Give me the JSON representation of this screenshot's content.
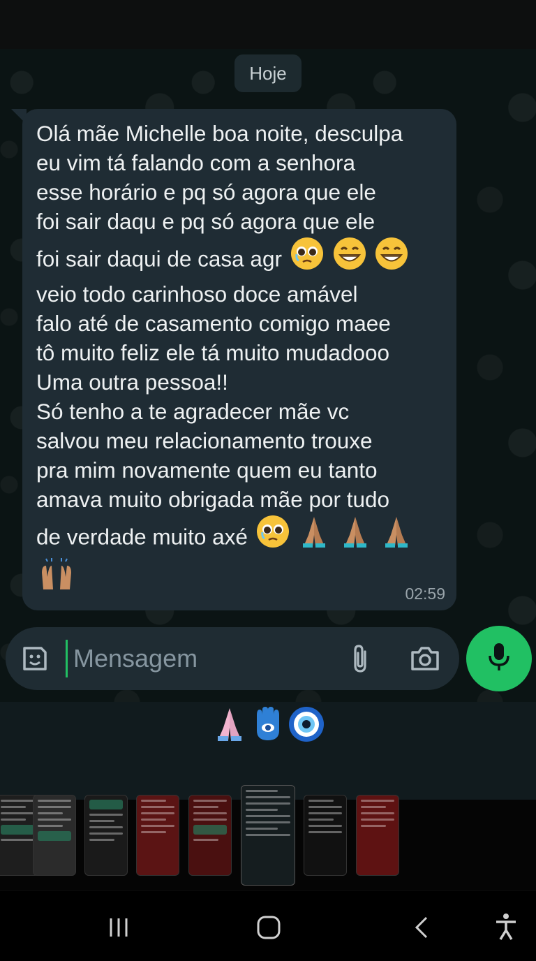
{
  "chat": {
    "date_chip": "Hoje",
    "message": {
      "lines": [
        "Olá mãe Michelle boa noite, desculpa",
        "eu vim tá falando com a senhora",
        "esse horário e pq só agora que ele",
        "foi sair daqu e pq só agora que ele",
        "foi sair daqui de casa agr",
        "veio todo carinhoso doce amável",
        "falo até de casamento comigo maee",
        "tô muito feliz ele tá muito mudadooo",
        "Uma outra pessoa!!",
        "Só tenho a te agradecer mãe vc",
        "salvou meu relacionamento trouxe",
        "pra mim novamente quem eu tanto",
        "amava muito obrigada mãe por tudo",
        "de verdade muito axé"
      ],
      "time": "02:59",
      "emojis_line5": [
        "pleading-face",
        "grinning-face",
        "grinning-face"
      ],
      "emojis_line14": [
        "pleading-face",
        "folded-hands",
        "folded-hands",
        "folded-hands"
      ],
      "emojis_last": [
        "raising-hands"
      ]
    }
  },
  "composer": {
    "placeholder": "Mensagem",
    "icons": [
      "sticker-icon",
      "paperclip-icon",
      "camera-icon",
      "microphone-icon"
    ],
    "accent": "#21c063"
  },
  "overlay_emojis": [
    "folded-hands",
    "hamsa",
    "nazar-amulet"
  ],
  "recent_apps": {
    "thumbnails": 9
  },
  "navigation": {
    "icons": [
      "recents-icon",
      "home-icon",
      "back-icon",
      "accessibility-icon"
    ]
  }
}
